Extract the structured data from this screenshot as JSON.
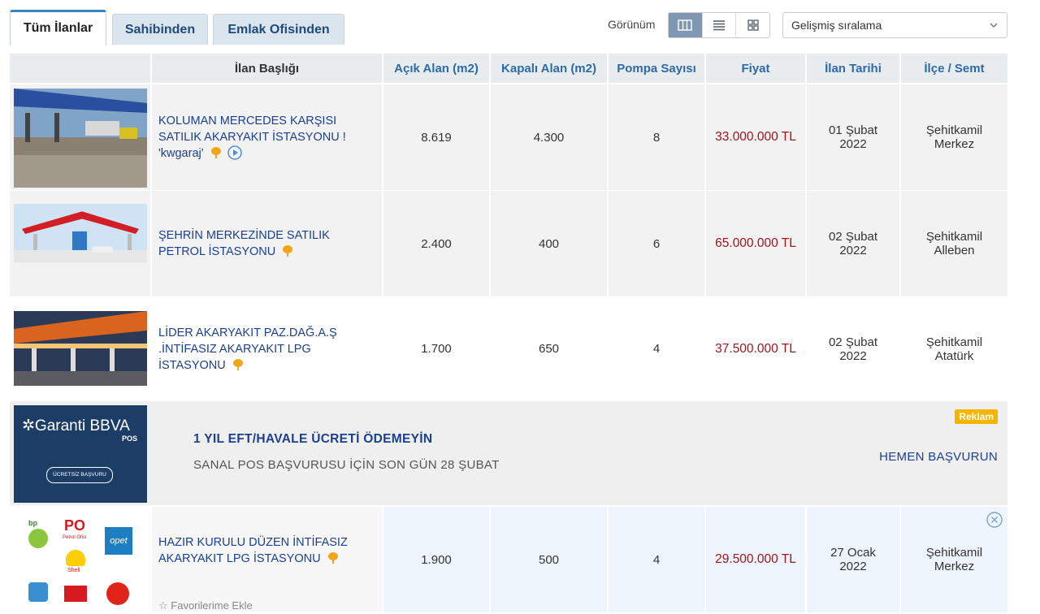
{
  "tabs": [
    {
      "label": "Tüm İlanlar",
      "active": true
    },
    {
      "label": "Sahibinden",
      "active": false
    },
    {
      "label": "Emlak Ofisinden",
      "active": false
    }
  ],
  "view": {
    "label": "Görünüm",
    "modes": [
      "table-view-icon",
      "list-view-icon",
      "grid-view-icon"
    ]
  },
  "sort": {
    "selected": "Gelişmiş sıralama"
  },
  "columns": [
    "İlan Başlığı",
    "Açık Alan (m2)",
    "Kapalı Alan (m2)",
    "Pompa Sayısı",
    "Fiyat",
    "İlan Tarihi",
    "İlçe / Semt"
  ],
  "listings": [
    {
      "title_lines": [
        "KOLUMAN MERCEDES KARŞISI",
        "SATILIK AKARYAKIT İSTASYONU !",
        "'kwgaraj'"
      ],
      "open_area": "8.619",
      "closed_area": "4.300",
      "pumps": "8",
      "price": "33.000.000 TL",
      "date_day": "01 Şubat",
      "date_year": "2022",
      "district": "Şehitkamil",
      "neighborhood": "Merkez",
      "has_video": true
    },
    {
      "title_lines": [
        "ŞEHRİN MERKEZİNDE SATILIK",
        "PETROL İSTASYONU"
      ],
      "open_area": "2.400",
      "closed_area": "400",
      "pumps": "6",
      "price": "65.000.000 TL",
      "date_day": "02 Şubat",
      "date_year": "2022",
      "district": "Şehitkamil",
      "neighborhood": "Alleben",
      "has_video": false
    },
    {
      "title_lines": [
        "LİDER AKARYAKIT PAZ.DAĞ.A.Ş",
        ".İNTİFASIZ AKARYAKIT LPG",
        "İSTASYONU"
      ],
      "open_area": "1.700",
      "closed_area": "650",
      "pumps": "4",
      "price": "37.500.000 TL",
      "date_day": "02 Şubat",
      "date_year": "2022",
      "district": "Şehitkamil",
      "neighborhood": "Atatürk",
      "has_video": false
    },
    {
      "title_lines": [
        "HAZIR KURULU DÜZEN İNTİFASIZ",
        "AKARYAKIT LPG İSTASYONU"
      ],
      "open_area": "1.900",
      "closed_area": "500",
      "pumps": "4",
      "price": "29.500.000 TL",
      "date_day": "27 Ocak",
      "date_year": "2022",
      "district": "Şehitkamil",
      "neighborhood": "Merkez",
      "has_video": false,
      "favorite_label": "Favorilerime Ekle"
    }
  ],
  "ad": {
    "brand": "Garanti BBVA",
    "brand_sub": "POS",
    "badge_button": "ÜCRETSİZ BAŞVURU",
    "tag": "Reklam",
    "title": "1 YIL EFT/HAVALE ÜCRETİ ÖDEMEYİN",
    "description": "SANAL POS BAŞVURUSU İÇİN SON GÜN 28 ŞUBAT",
    "cta": "HEMEN BAŞVURUN"
  },
  "logos": [
    "bp",
    "PO",
    "Petrol Ofisi",
    "Shell",
    "opet"
  ],
  "colors": {
    "price": "#a0151b",
    "link": "#1b3f8f",
    "header_link": "#2c6aa8",
    "reklam": "#f7b500",
    "garanti_bg": "#1c3d66"
  }
}
